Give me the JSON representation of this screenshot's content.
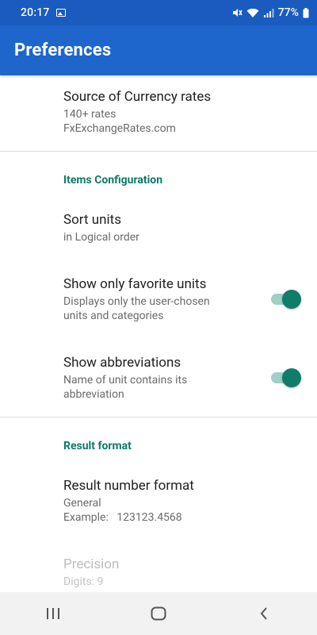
{
  "status_bar": {
    "time": "20:17",
    "battery": "77%",
    "icons": [
      "gallery-icon",
      "mute-icon",
      "wifi-icon",
      "signal-icon",
      "battery-icon"
    ]
  },
  "app_bar": {
    "title": "Preferences"
  },
  "preferences": {
    "currency": {
      "title": "Source of Currency rates",
      "summary_line1": "140+ rates",
      "summary_line2": "FxExchangeRates.com"
    },
    "items_category": "Items Configuration",
    "sort_units": {
      "title": "Sort units",
      "summary": "in Logical order"
    },
    "favorite_units": {
      "title": "Show only favorite units",
      "summary_line1": "Displays only the user-chosen",
      "summary_line2": "units and categories",
      "enabled": true
    },
    "abbreviations": {
      "title": "Show abbreviations",
      "summary_line1": "Name of unit contains its",
      "summary_line2": "abbreviation",
      "enabled": true
    },
    "result_category": "Result format",
    "number_format": {
      "title": "Result number format",
      "summary_line1": "General",
      "summary_line2": "Example:   123123.4568"
    },
    "precision": {
      "title": "Precision",
      "summary": "Digits: 9",
      "disabled": true
    }
  },
  "nav_bar": {
    "buttons": [
      "recents-icon",
      "home-icon",
      "back-icon"
    ]
  },
  "colors": {
    "status_bar": "#1a5bbf",
    "app_bar": "#1e66cc",
    "accent": "#0d7a68",
    "switch_track": "#9fcfc5",
    "switch_thumb": "#0f7d69"
  }
}
